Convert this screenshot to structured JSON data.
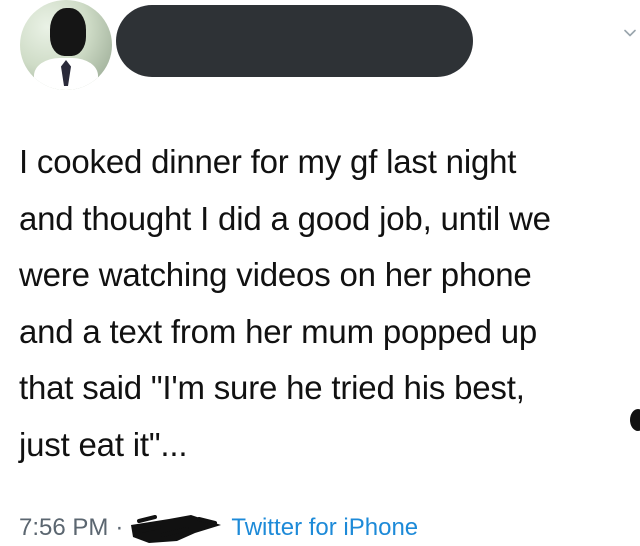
{
  "tweet": {
    "text": "I cooked dinner for my gf last night\nand thought I did a good job, until we\nwere watching videos on her phone\nand a text from her mum popped up\nthat said \"I'm sure he tried his best,\njust eat it\"...",
    "time": "7:56 PM",
    "separator": "·",
    "source": "Twitter for iPhone"
  },
  "icons": {
    "menu": "chevron-down-icon"
  },
  "colors": {
    "text": "#111111",
    "meta": "#5b6670",
    "link": "#1d8ad8",
    "redaction": "#2e3236"
  }
}
